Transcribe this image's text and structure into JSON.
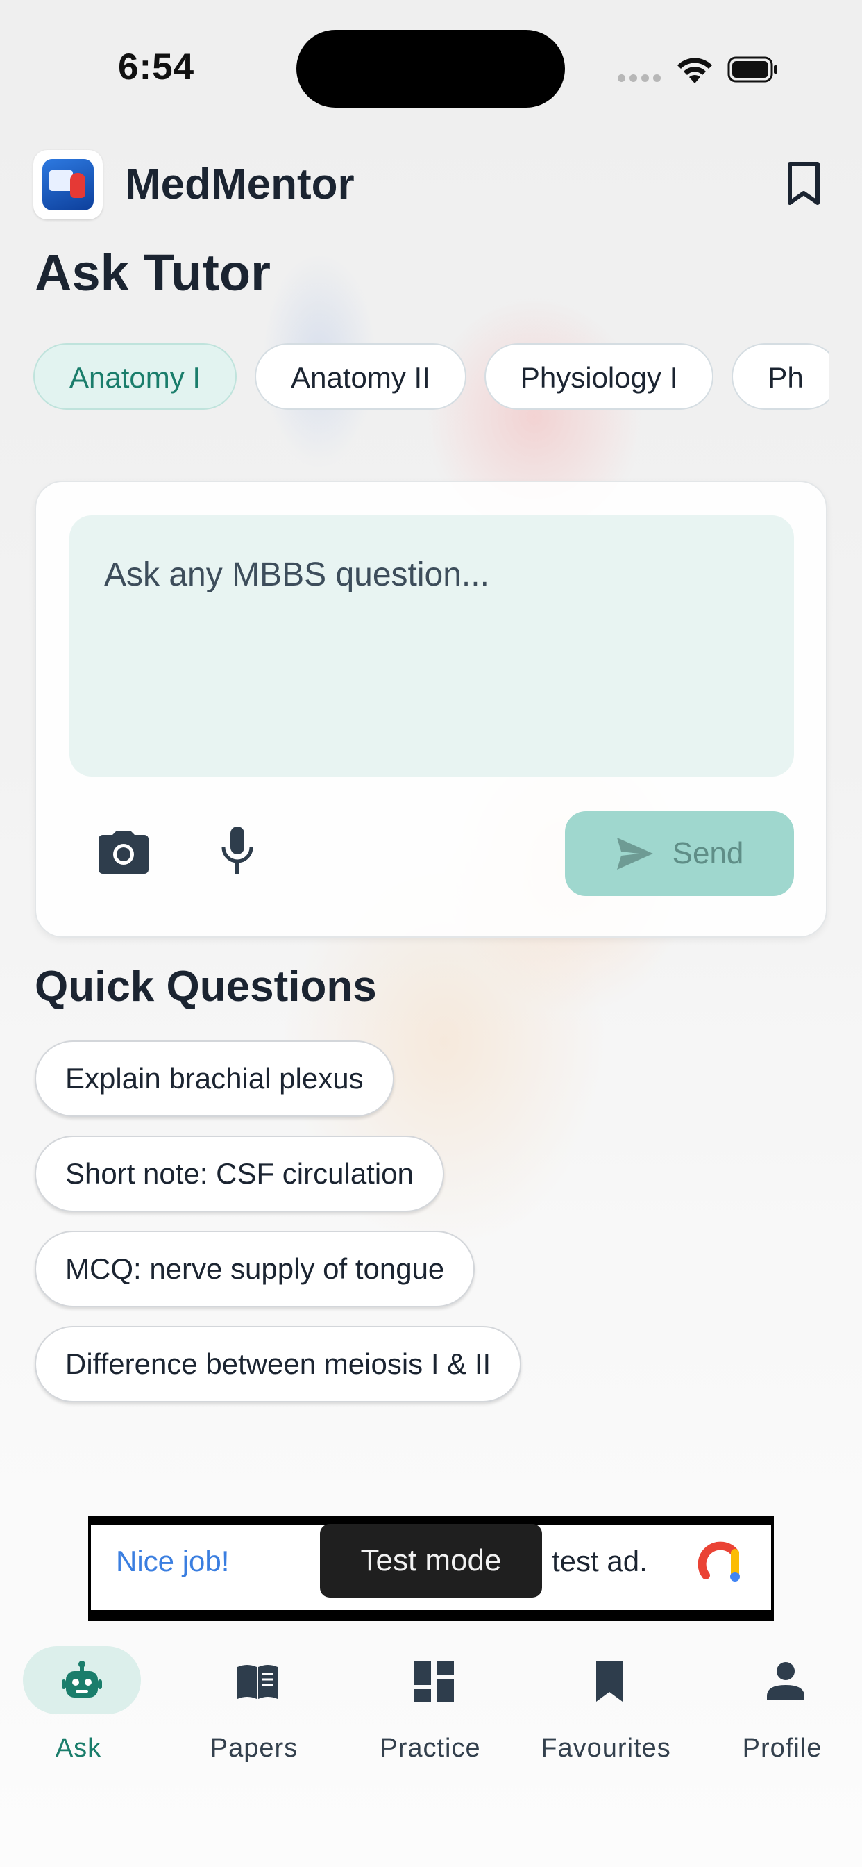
{
  "status_bar": {
    "time": "6:54"
  },
  "header": {
    "app_name": "MedMentor"
  },
  "page": {
    "title": "Ask Tutor"
  },
  "subjects": [
    {
      "label": "Anatomy I",
      "active": true
    },
    {
      "label": "Anatomy II",
      "active": false
    },
    {
      "label": "Physiology I",
      "active": false
    },
    {
      "label": "Ph",
      "active": false
    }
  ],
  "composer": {
    "placeholder": "Ask any MBBS question...",
    "value": "",
    "send_label": "Send"
  },
  "quick_questions": {
    "title": "Quick Questions",
    "items": [
      "Explain brachial plexus",
      "Short note: CSF circulation",
      "MCQ: nerve supply of tongue",
      "Difference between meiosis I & II"
    ]
  },
  "ad": {
    "headline": "Nice job!",
    "text": "test ad.",
    "toast": "Test mode"
  },
  "tabs": [
    {
      "label": "Ask",
      "icon": "robot-icon",
      "active": true
    },
    {
      "label": "Papers",
      "icon": "book-icon",
      "active": false
    },
    {
      "label": "Practice",
      "icon": "dashboard-icon",
      "active": false
    },
    {
      "label": "Favourites",
      "icon": "bookmark-icon",
      "active": false
    },
    {
      "label": "Profile",
      "icon": "person-icon",
      "active": false
    }
  ],
  "colors": {
    "accent": "#1a7d6b",
    "accent_soft": "#e2f3f0",
    "send_disabled": "#9fd7ce",
    "text": "#1b2431"
  }
}
